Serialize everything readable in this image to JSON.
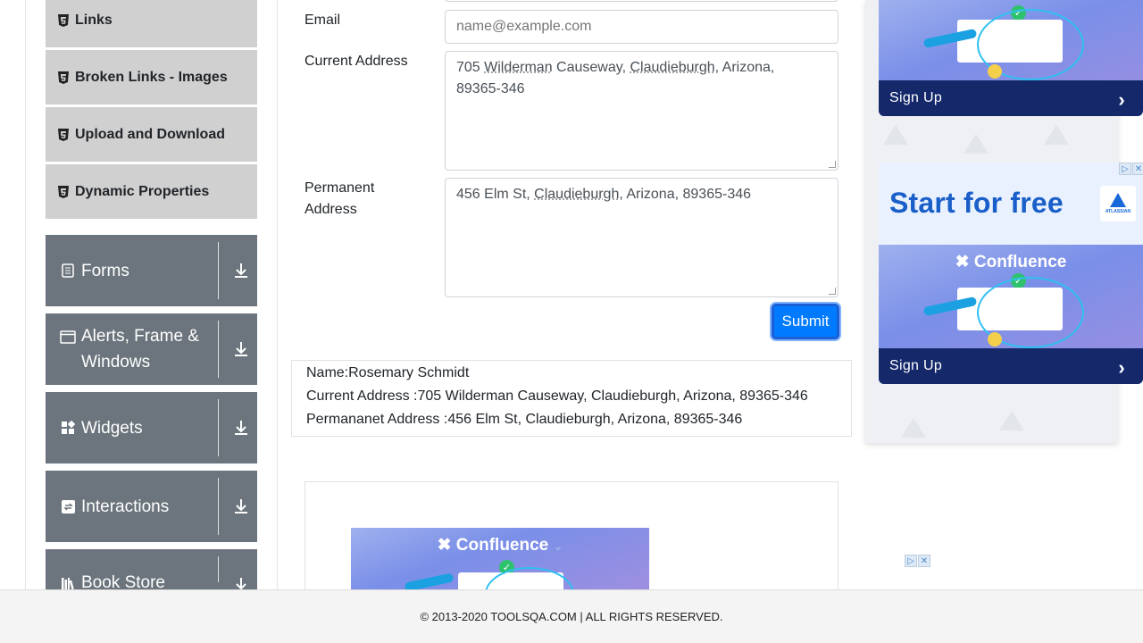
{
  "sidebar": {
    "sub_items": [
      {
        "label": "Links"
      },
      {
        "label": "Broken Links - Images"
      },
      {
        "label": "Upload and Download"
      },
      {
        "label": "Dynamic Properties"
      }
    ],
    "groups": [
      {
        "label": "Forms",
        "icon": "document-icon"
      },
      {
        "label": "Alerts, Frame & Windows",
        "icon": "window-icon"
      },
      {
        "label": "Widgets",
        "icon": "widgets-icon"
      },
      {
        "label": "Interactions",
        "icon": "interactions-icon"
      },
      {
        "label": "Book Store",
        "icon": "books-icon"
      }
    ]
  },
  "form": {
    "email_label": "Email",
    "email_placeholder": "name@example.com",
    "current_label": "Current Address",
    "current_value": {
      "p1": "705 ",
      "w1": "Wilderman",
      "p2": " Causeway, ",
      "w2": "Claudieburgh",
      "p3": ", Arizona,",
      "p4": "89365-346"
    },
    "permanent_label_1": "Permanent",
    "permanent_label_2": "Address",
    "permanent_value": {
      "p1": "456 Elm St, ",
      "w1": "Claudieburgh",
      "p2": ", Arizona, 89365-346"
    },
    "submit_label": "Submit"
  },
  "output": {
    "name": "Name:Rosemary Schmidt",
    "current": "Current Address :705 Wilderman Causeway, Claudieburgh, Arizona, 89365-346",
    "permanent": "Permananet Address :456 Elm St, Claudieburgh, Arizona, 89365-346"
  },
  "ads": {
    "signup": "Sign Up",
    "start_free": "Start for free",
    "confluence": "Confluence",
    "atlassian": "ATLASSIAN"
  },
  "footer": {
    "text": "© 2013-2020 TOOLSQA.COM | ALL RIGHTS RESERVED."
  }
}
